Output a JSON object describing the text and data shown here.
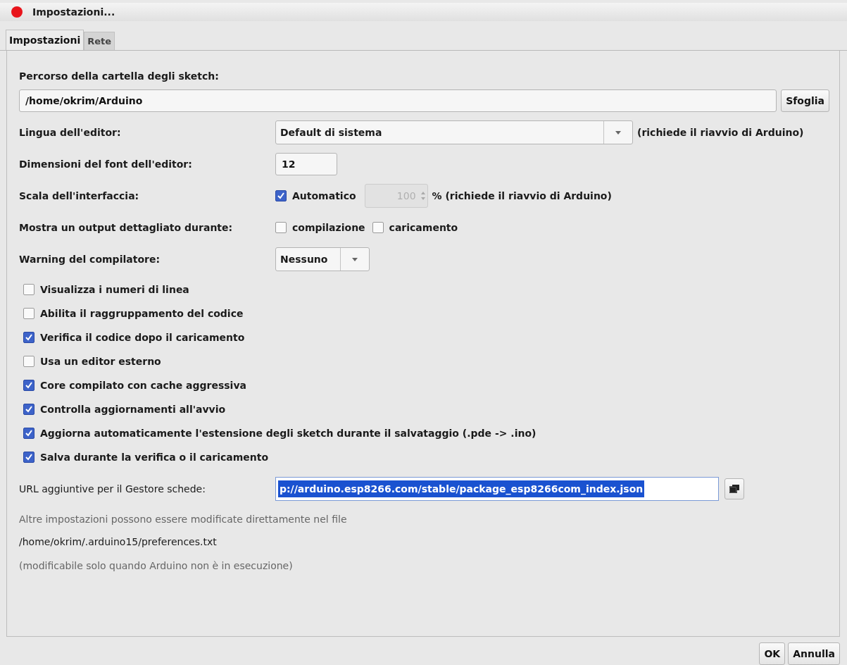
{
  "window": {
    "title": "Impostazioni..."
  },
  "tabs": [
    {
      "label": "Impostazioni",
      "selected": true
    },
    {
      "label": "Rete",
      "selected": false
    }
  ],
  "sketchbook": {
    "label": "Percorso della cartella degli sketch:",
    "value": "/home/okrim/Arduino",
    "button": "Sfoglia"
  },
  "language": {
    "label": "Lingua dell'editor:",
    "value": "Default di sistema",
    "note": "(richiede il riavvio di Arduino)"
  },
  "font_size": {
    "label": "Dimensioni del font dell'editor:",
    "value": "12"
  },
  "interface_scale": {
    "label": "Scala dell'interfaccia:",
    "automatic": {
      "label": "Automatico",
      "checked": true
    },
    "value": "100",
    "disabled": true,
    "note": "% (richiede il riavvio di Arduino)"
  },
  "verbose": {
    "label": "Mostra un output dettagliato durante:",
    "options": [
      {
        "label": "compilazione",
        "checked": false
      },
      {
        "label": "caricamento",
        "checked": false
      }
    ]
  },
  "warnings": {
    "label": "Warning del compilatore:",
    "value": "Nessuno"
  },
  "checkboxes": [
    {
      "label": "Visualizza i numeri di linea",
      "checked": false
    },
    {
      "label": "Abilita il raggruppamento del codice",
      "checked": false
    },
    {
      "label": "Verifica il codice dopo il caricamento",
      "checked": true
    },
    {
      "label": "Usa un editor esterno",
      "checked": false
    },
    {
      "label": "Core compilato con cache aggressiva",
      "checked": true
    },
    {
      "label": "Controlla aggiornamenti all'avvio",
      "checked": true
    },
    {
      "label": "Aggiorna automaticamente l'estensione degli sketch durante il salvataggio (.pde -> .ino)",
      "checked": true
    },
    {
      "label": "Salva durante la verifica o il caricamento",
      "checked": true
    }
  ],
  "board_urls": {
    "label": "URL aggiuntive per il Gestore schede:",
    "value": "p://arduino.esp8266.com/stable/package_esp8266com_index.json",
    "selected": true
  },
  "notes": {
    "info": "Altre impostazioni possono essere modificate direttamente nel file",
    "path": "/home/okrim/.arduino15/preferences.txt",
    "hint": "(modificabile solo quando Arduino non è in esecuzione)"
  },
  "buttons": [
    "OK",
    "Annulla"
  ]
}
